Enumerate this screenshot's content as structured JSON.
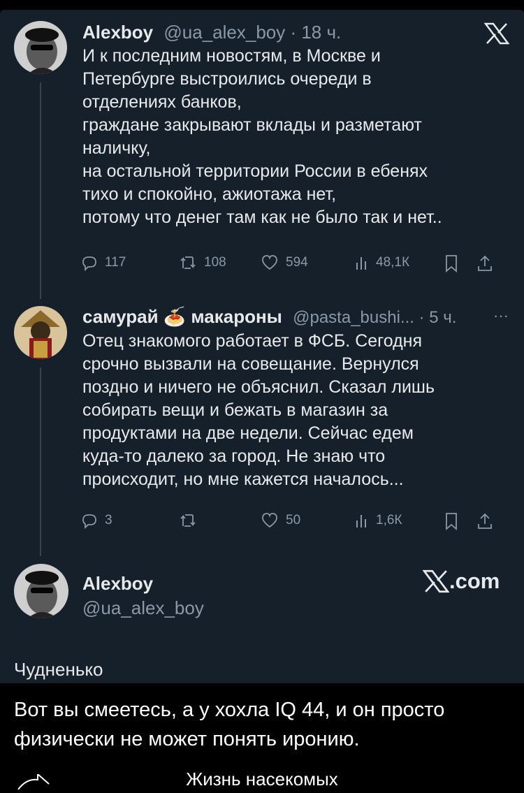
{
  "tweet1": {
    "name": "Alexboy",
    "meta": "@ua_alex_boy · 18 ч.",
    "lines": [
      "И к последним новостям, в Москве и",
      "Петербурге выстроились очереди в",
      "отделениях банков,",
      "граждане закрывают вклады и разметают",
      "наличку,",
      "на остальной территории России в ебенях",
      "тихо и спокойно, ажиотажа нет,",
      "потому что денег там как не было так и нет.."
    ],
    "stats": {
      "replies": "117",
      "retweets": "108",
      "likes": "594",
      "views": "48,1К"
    }
  },
  "tweet2": {
    "name": "самурай 🍝 макароны",
    "meta": "@pasta_bushi... · 5 ч.",
    "more": "···",
    "lines": [
      "Отец знакомого работает в ФСБ. Сегодня",
      "срочно вызвали на совещание. Вернулся",
      "поздно и ничего не объяснил. Сказал лишь",
      "собирать вещи и бежать в магазин за",
      "продуктами на две недели. Сейчас едем",
      "куда-то далеко за город. Не знаю что",
      "происходит, но мне кажется началось..."
    ],
    "stats": {
      "replies": "3",
      "retweets": "",
      "likes": "50",
      "views": "1,6К"
    }
  },
  "footer_card": {
    "name": "Alexboy",
    "handle": "@ua_alex_boy",
    "brand": ".com"
  },
  "caption": "Чудненько",
  "meme": {
    "lines": [
      "Вот вы смеетесь, а у хохла IQ 44, и он просто",
      "физически не может понять иронию."
    ],
    "bottom": "Жизнь насекомых"
  },
  "icons": [
    "x-logo-icon",
    "reply-icon",
    "retweet-icon",
    "like-icon",
    "views-icon",
    "bookmark-icon",
    "share-icon"
  ],
  "colors": {
    "background": "#15202b",
    "text": "#e7e9ea",
    "muted": "#8b98a5"
  }
}
